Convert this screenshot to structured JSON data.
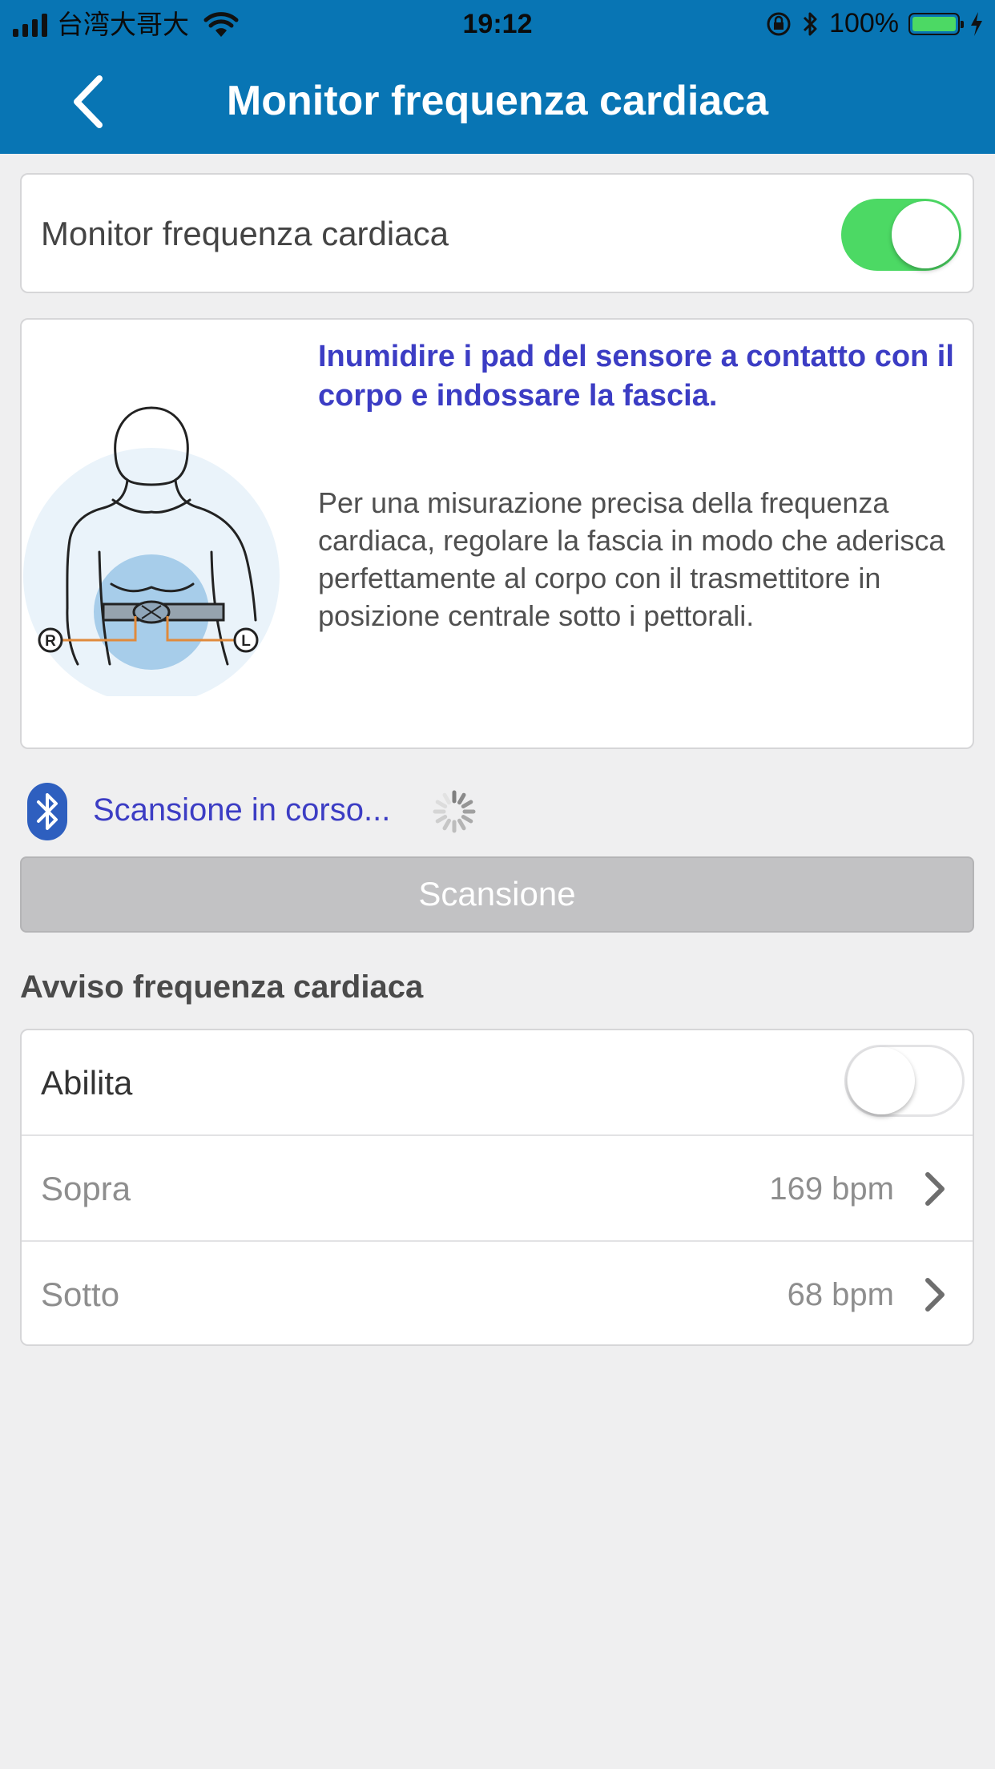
{
  "status_bar": {
    "carrier": "台湾大哥大",
    "time": "19:12",
    "battery": "100%"
  },
  "nav": {
    "title": "Monitor frequenza cardiaca",
    "back_icon": "chevron-left-icon"
  },
  "monitor_toggle": {
    "label": "Monitor frequenza cardiaca",
    "on": true
  },
  "info": {
    "title": "Inumidire i pad del sensore a contatto con il corpo e indossare la fascia.",
    "body": "Per una misurazione precisa della frequenza cardiaca, regolare la fascia in modo che aderisca perfettamente al corpo con il trasmettitore in posizione centrale sotto i pettorali.",
    "illustration": {
      "right_marker": "R",
      "left_marker": "L"
    }
  },
  "scan": {
    "status_text": "Scansione in corso...",
    "button_label": "Scansione"
  },
  "alert": {
    "section_title": "Avviso frequenza cardiaca",
    "enable_label": "Abilita",
    "enabled": false,
    "rows": [
      {
        "label": "Sopra",
        "value": "169 bpm"
      },
      {
        "label": "Sotto",
        "value": "68 bpm"
      }
    ]
  },
  "colors": {
    "header": "#0875b4",
    "accent_text": "#3c3dc4",
    "toggle_on": "#4cd964",
    "background": "#efeff0"
  }
}
